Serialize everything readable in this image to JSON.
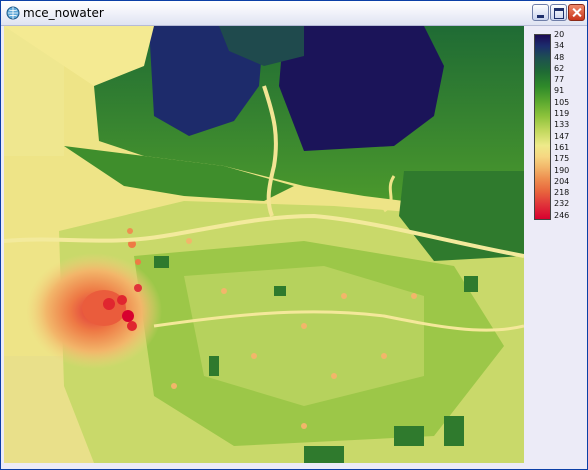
{
  "window": {
    "title": "mce_nowater"
  },
  "icons": {
    "app": "globe-app-icon",
    "minimize": "minimize-icon",
    "maximize": "maximize-icon",
    "close": "close-icon"
  },
  "legend": {
    "labels": [
      "20",
      "34",
      "48",
      "62",
      "77",
      "91",
      "105",
      "119",
      "133",
      "147",
      "161",
      "175",
      "190",
      "204",
      "218",
      "232",
      "246"
    ],
    "colors": {
      "low": "#1b0a55",
      "mid": "#eeea8a",
      "high": "#d8002f"
    }
  },
  "colors": {
    "title_bar": "#ecebf7",
    "window_bg": "#ecebf7",
    "accent_close": "#c8351b"
  }
}
